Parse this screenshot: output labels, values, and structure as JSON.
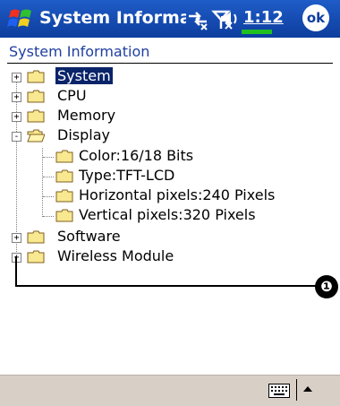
{
  "titlebar": {
    "app_title": "System Informa",
    "clock": "1:12",
    "ok_label": "ok"
  },
  "header": {
    "title": "System Information"
  },
  "tree": {
    "items": [
      {
        "label": "System",
        "expander": "+",
        "selected": true
      },
      {
        "label": "CPU",
        "expander": "+"
      },
      {
        "label": "Memory",
        "expander": "+"
      },
      {
        "label": "Display",
        "expander": "-"
      },
      {
        "label": "Color:16/18 Bits"
      },
      {
        "label": "Type:TFT-LCD"
      },
      {
        "label": "Horizontal pixels:240 Pixels"
      },
      {
        "label": "Vertical pixels:320 Pixels"
      },
      {
        "label": "Software",
        "expander": "+"
      },
      {
        "label": "Wireless Module",
        "expander": "+"
      }
    ]
  },
  "callout": {
    "number": "❶"
  },
  "colors": {
    "titlebar": "#0d3d9e",
    "selection": "#0a246a",
    "header_text": "#1f3fa0",
    "bottombar": "#d8cfc6"
  },
  "icons": [
    "windows-start-icon",
    "connectivity-icon",
    "signal-icon",
    "volume-icon",
    "ok-button",
    "folder-icon",
    "keyboard-icon",
    "arrow-up-icon"
  ]
}
